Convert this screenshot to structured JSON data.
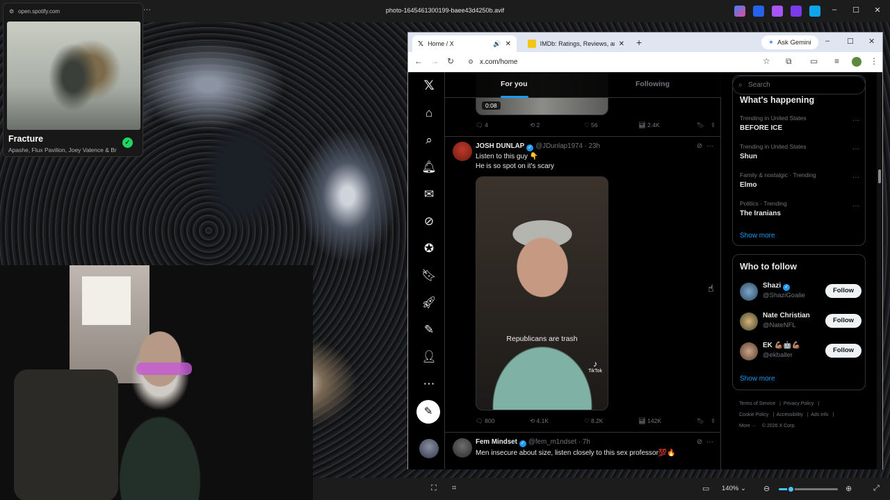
{
  "window": {
    "title": "photo-1645461300199-baee43d4250b.avif",
    "controls": [
      "–",
      "☐",
      "✕"
    ]
  },
  "spotify": {
    "url": "open.spotify.com",
    "track": "Fracture",
    "artists": "Apashe, Flux Pavilion, Joey Valence & Br"
  },
  "browser": {
    "tabs": [
      {
        "label": "Home / X",
        "active": true
      },
      {
        "label": "IMDb: Ratings, Reviews, and W",
        "active": false
      }
    ],
    "new_tab": "+",
    "gemini": "Ask Gemini",
    "url": "x.com/home"
  },
  "x": {
    "feed_tabs": [
      "For you",
      "Following"
    ],
    "prev_tweet": {
      "video_time": "0:08",
      "replies": "4",
      "reposts": "2",
      "likes": "56",
      "views": "2.4K"
    },
    "tweet1": {
      "name": "JOSH DUNLAP",
      "handle": "@JDunlap1974 · 23h",
      "line1": "Listen to this guy 👇",
      "line2": "He is so spot on it's scary",
      "caption": "Republicans are trash",
      "tiktok": "TikTok",
      "replies": "800",
      "reposts": "4.1K",
      "likes": "8.2K",
      "views": "142K"
    },
    "tweet2": {
      "name": "Fem Mindset",
      "handle": "@fem_m1ndset · 7h",
      "text": "Men insecure about size, listen closely to this sex professor💯🔥"
    },
    "search_placeholder": "Search",
    "trends_header": "What's happening",
    "trends": [
      {
        "context": "Trending in United States",
        "name": "BEFORE ICE"
      },
      {
        "context": "Trending in United States",
        "name": "Shun"
      },
      {
        "context": "Family & nostalgic · Trending",
        "name": "Elmo"
      },
      {
        "context": "Politics · Trending",
        "name": "The Iranians"
      }
    ],
    "show_more": "Show more",
    "who_to_follow": {
      "title": "Who to follow",
      "accounts": [
        {
          "name": "Shazi",
          "handle": "@ShaziGoalie"
        },
        {
          "name": "Nate Christian",
          "handle": "@NateNFL"
        },
        {
          "name": "EK 💪🏽🤖💪🏽",
          "handle": "@ekballer"
        }
      ],
      "follow_label": "Follow",
      "show_more": "Show more"
    },
    "footer": [
      "Terms of Service",
      "Privacy Policy",
      "Cookie Policy",
      "Accessibility",
      "Ads info",
      "More ···",
      "© 2026 X Corp."
    ]
  },
  "viewer": {
    "zoom": "140%",
    "zoom_level": 0.2
  }
}
